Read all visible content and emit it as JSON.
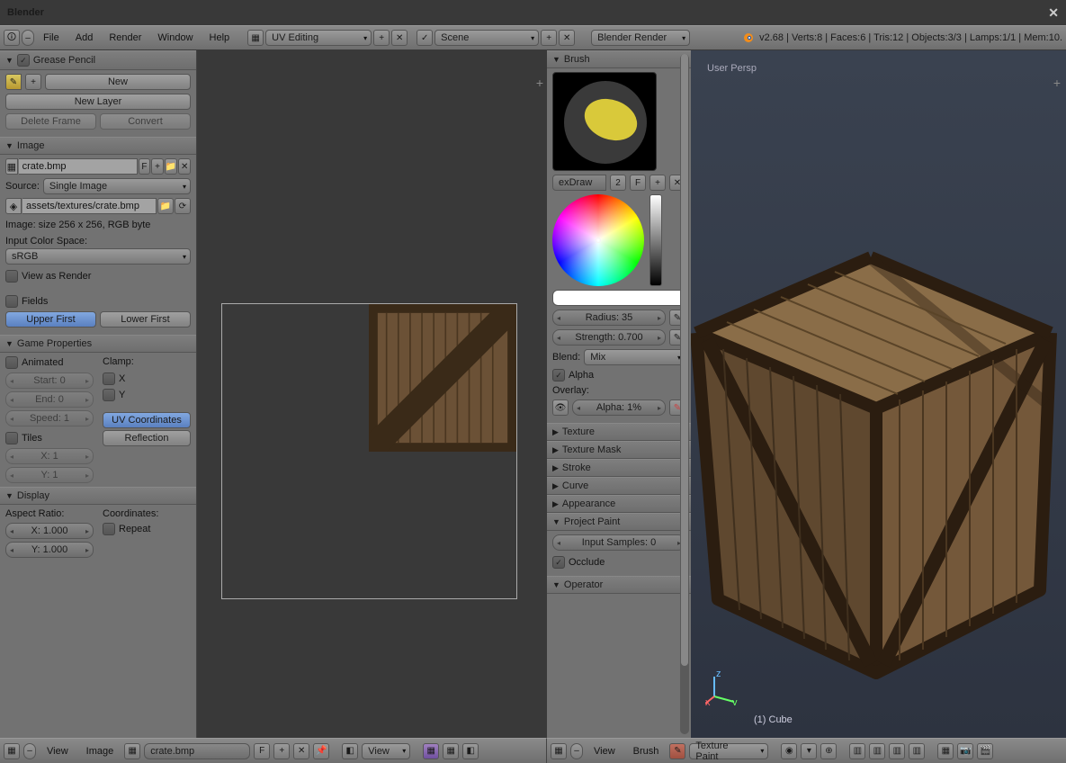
{
  "app_title": "Blender",
  "top_menu": [
    "File",
    "Add",
    "Render",
    "Window",
    "Help"
  ],
  "layout_preset": "UV Editing",
  "scene_name": "Scene",
  "render_engine": "Blender Render",
  "stats_line": "v2.68 | Verts:8 | Faces:6 | Tris:12 | Objects:3/3 | Lamps:1/1 | Mem:10.",
  "grease": {
    "title": "Grease Pencil",
    "new": "New",
    "new_layer": "New Layer",
    "delete_frame": "Delete Frame",
    "convert": "Convert"
  },
  "image": {
    "title": "Image",
    "name": "crate.bmp",
    "f_btn": "F",
    "source_label": "Source:",
    "source_value": "Single Image",
    "path": "assets/textures/crate.bmp",
    "info": "Image: size 256 x 256, RGB byte",
    "colorspace_label": "Input Color Space:",
    "colorspace_value": "sRGB",
    "view_as_render": "View as Render",
    "fields": "Fields",
    "upper_first": "Upper First",
    "lower_first": "Lower First"
  },
  "gameprops": {
    "title": "Game Properties",
    "animated": "Animated",
    "clamp": "Clamp:",
    "clamp_x": "X",
    "clamp_y": "Y",
    "start": "Start: 0",
    "end": "End: 0",
    "speed": "Speed: 1",
    "tiles": "Tiles",
    "xtiles": "X: 1",
    "ytiles": "Y: 1",
    "uv_coords": "UV Coordinates",
    "reflection": "Reflection"
  },
  "display": {
    "title": "Display",
    "aspect_label": "Aspect Ratio:",
    "coords_label": "Coordinates:",
    "ax": "X: 1.000",
    "ay": "Y: 1.000",
    "repeat": "Repeat"
  },
  "brush": {
    "title": "Brush",
    "preset": "exDraw",
    "preset_count": "2",
    "f_btn": "F",
    "radius": "Radius: 35",
    "strength": "Strength: 0.700",
    "blend_label": "Blend:",
    "blend_value": "Mix",
    "alpha": "Alpha",
    "overlay_label": "Overlay:",
    "overlay_alpha": "Alpha: 1%",
    "sections": [
      "Texture",
      "Texture Mask",
      "Stroke",
      "Curve",
      "Appearance"
    ],
    "project_paint": "Project Paint",
    "input_samples": "Input Samples: 0",
    "occlude": "Occlude",
    "operator": "Operator"
  },
  "viewport": {
    "persp": "User Persp",
    "object": "(1) Cube"
  },
  "footer_left": {
    "view": "View",
    "image": "Image",
    "imgname": "crate.bmp",
    "f_btn": "F",
    "view_dd": "View"
  },
  "footer_right": {
    "view": "View",
    "brush": "Brush",
    "mode": "Texture Paint"
  }
}
